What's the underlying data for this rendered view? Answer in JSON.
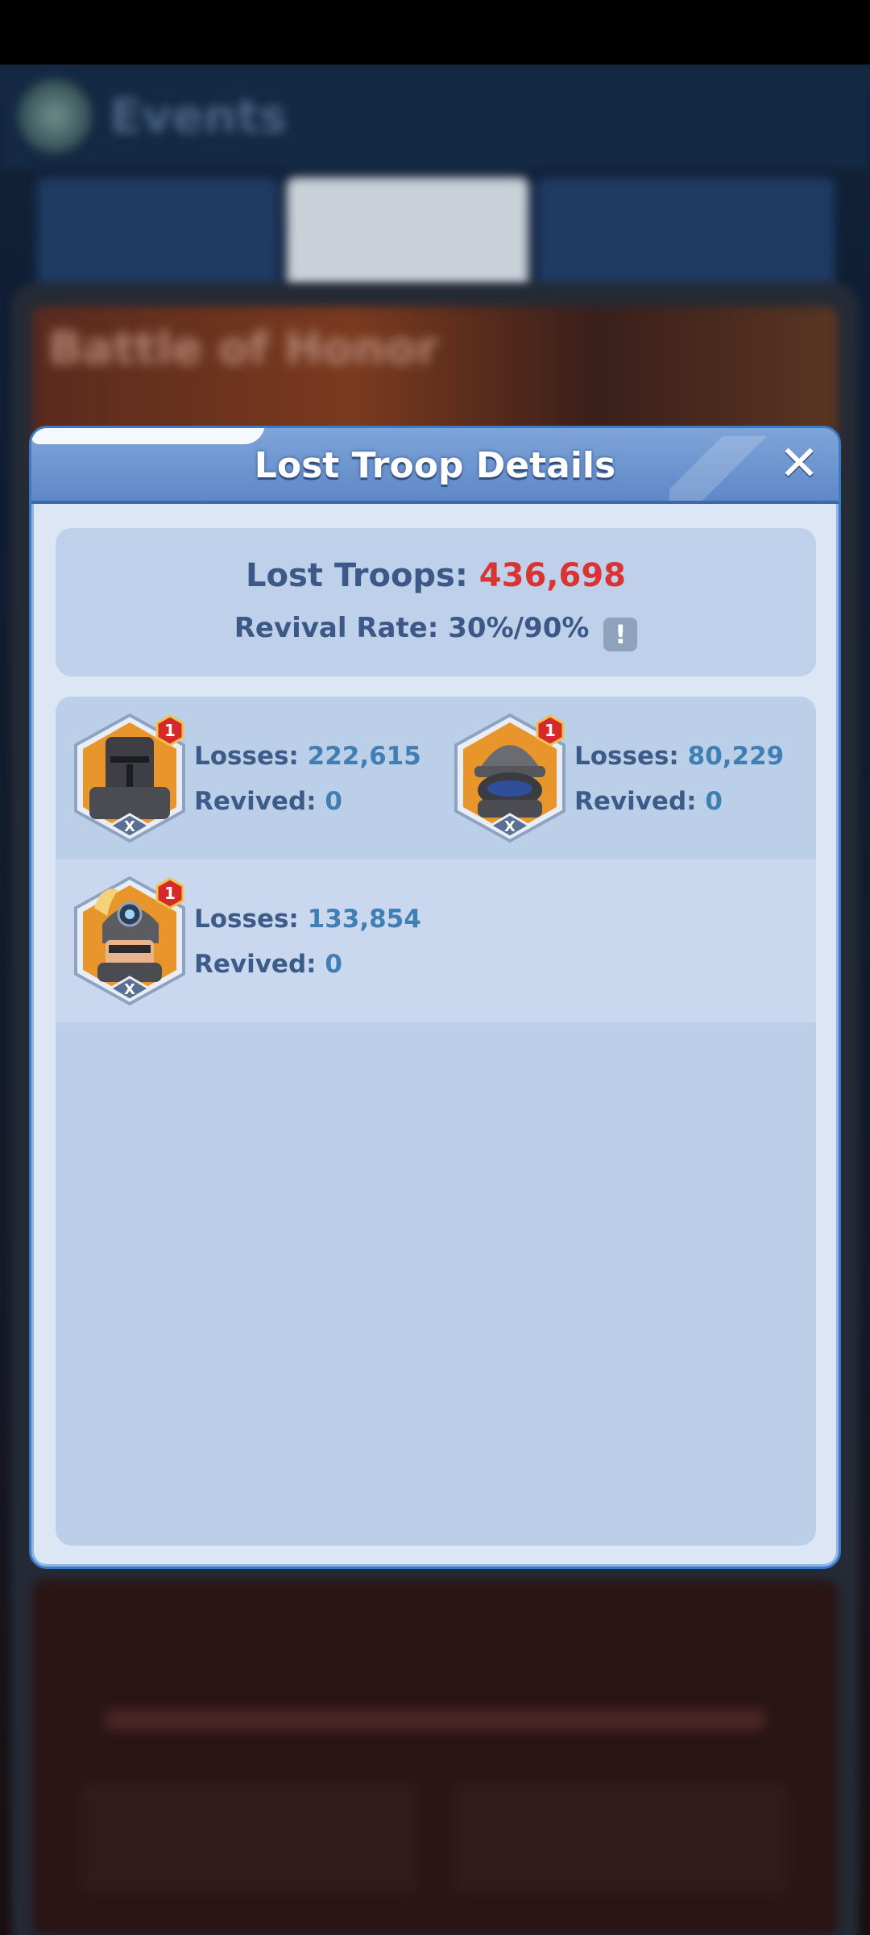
{
  "background": {
    "title": "Events",
    "banner_title": "Battle of Honor"
  },
  "modal": {
    "title": "Lost Troop Details",
    "close_icon": "close-icon",
    "summary": {
      "lost_troops_label": "Lost Troops:",
      "lost_troops_value": "436,698",
      "revival_rate_label": "Revival Rate:",
      "revival_rate_value": "30%/90%",
      "info_icon_glyph": "!"
    },
    "troops": [
      {
        "type": "armored-knight",
        "level": "1",
        "tier": "X",
        "losses_label": "Losses:",
        "losses_value": "222,615",
        "revived_label": "Revived:",
        "revived_value": "0"
      },
      {
        "type": "helmet-soldier",
        "level": "1",
        "tier": "X",
        "losses_label": "Losses:",
        "losses_value": "80,229",
        "revived_label": "Revived:",
        "revived_value": "0"
      },
      {
        "type": "goggle-soldier",
        "level": "1",
        "tier": "X",
        "losses_label": "Losses:",
        "losses_value": "133,854",
        "revived_label": "Revived:",
        "revived_value": "0"
      }
    ]
  },
  "colors": {
    "header_blue": "#5f88c7",
    "panel_light": "#dce6f5",
    "lost_value_red": "#d83434",
    "label_navy": "#3b5886",
    "value_blue": "#3f7fb4",
    "badge_red": "#d62a2a"
  }
}
